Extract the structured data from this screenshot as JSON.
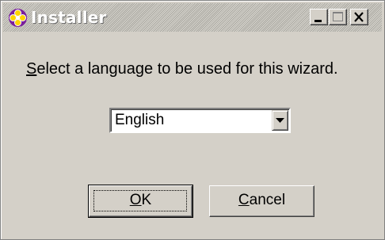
{
  "window": {
    "title": "Installer"
  },
  "titlebar_buttons": {
    "minimize_icon": "minimize-icon",
    "maximize_icon": "maximize-icon",
    "close_icon": "close-icon"
  },
  "prompt": {
    "mnemonic": "S",
    "rest": "elect a language to be used for this wizard."
  },
  "language_select": {
    "value": "English"
  },
  "buttons": {
    "ok": {
      "mnemonic": "O",
      "rest": "K"
    },
    "cancel": {
      "mnemonic": "C",
      "rest": "ancel"
    }
  },
  "colors": {
    "face": "#d4d0c8",
    "icon_purple": "#7a1f9c",
    "icon_yellow": "#ffd400"
  }
}
